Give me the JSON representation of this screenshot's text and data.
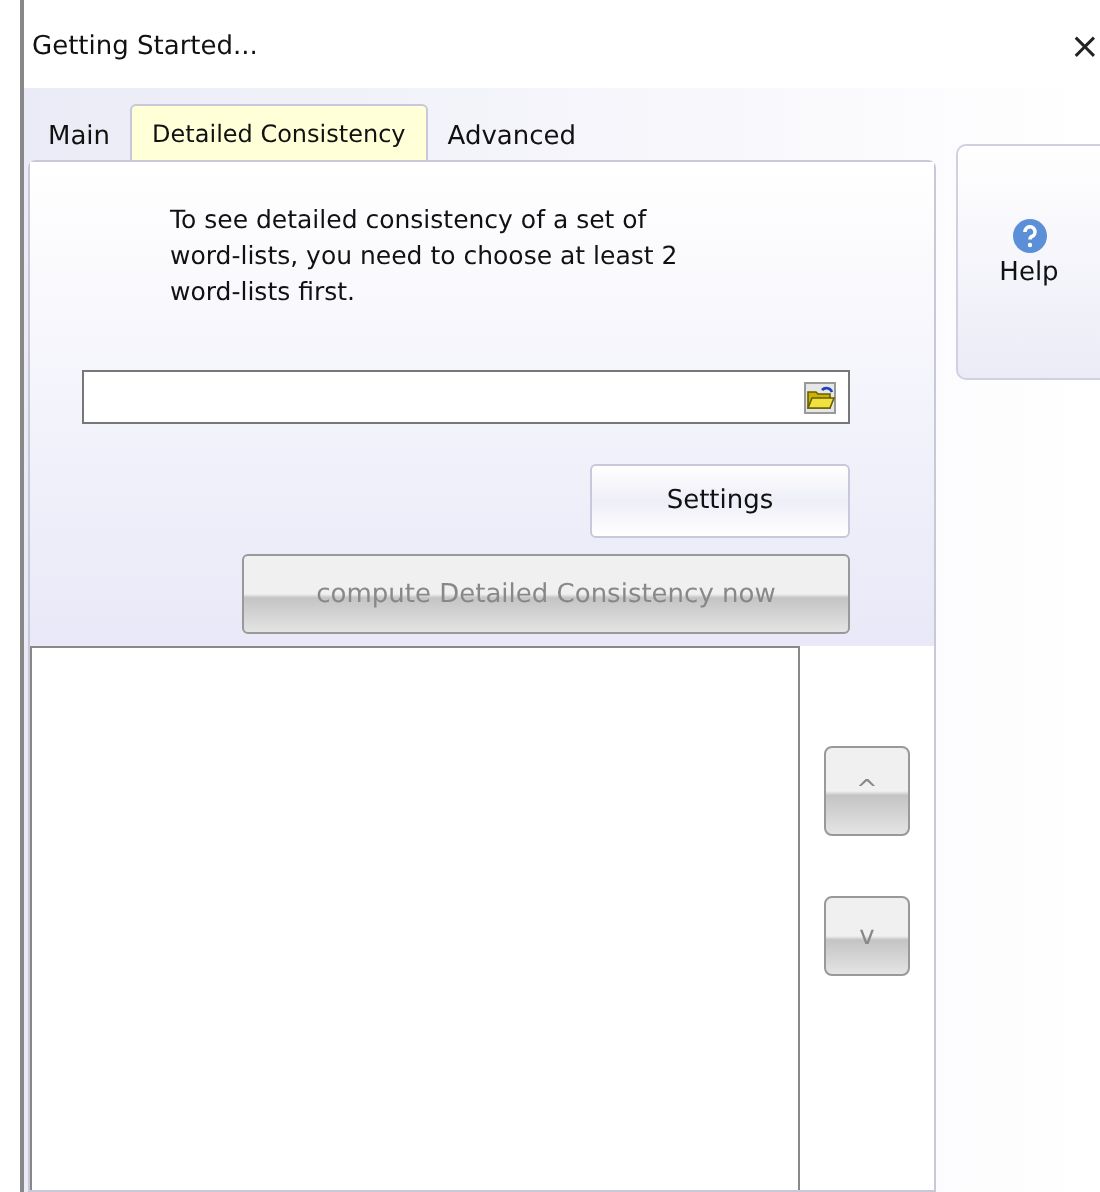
{
  "window": {
    "title": "Getting Started...",
    "close": "×"
  },
  "tabs": [
    {
      "label": "Main",
      "selected": false
    },
    {
      "label": "Detailed Consistency",
      "selected": true
    },
    {
      "label": "Advanced",
      "selected": false
    }
  ],
  "instructions": "To see detailed consistency of a set of word-lists, you need to choose at least 2 word-lists first.",
  "settings_button": {
    "label": "Settings",
    "disabled": false
  },
  "compute_button": {
    "label": "compute Detailed Consistency now",
    "disabled": true
  },
  "move_buttons": [
    {
      "label": "^",
      "disabled": true
    },
    {
      "label": "v",
      "disabled": true
    }
  ],
  "help_button": {
    "label": "Help"
  }
}
